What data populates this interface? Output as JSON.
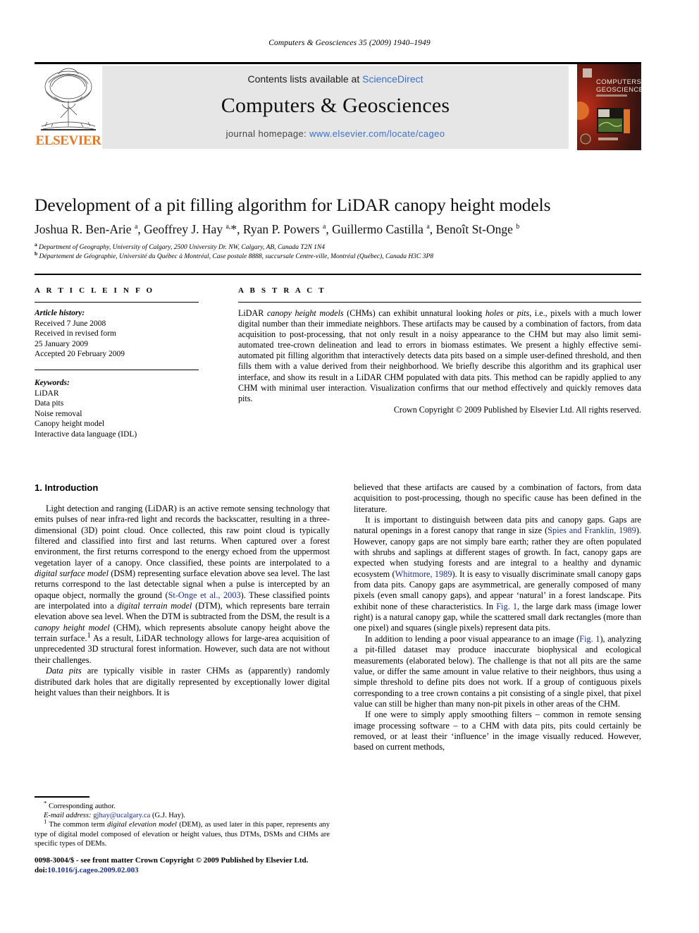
{
  "running_head": "Computers & Geosciences 35 (2009) 1940–1949",
  "masthead": {
    "publisher_name": "ELSEVIER",
    "contents_prefix": "Contents lists available at ",
    "contents_link": "ScienceDirect",
    "journal_name": "Computers & Geosciences",
    "homepage_prefix": "journal homepage: ",
    "homepage_url": "www.elsevier.com/locate/cageo",
    "cover_title_line1": "COMPUTERS",
    "cover_title_line2": "GEOSCIENCES",
    "cover_accent": "#e87722",
    "cover_bg": "#3a1510"
  },
  "article": {
    "title": "Development of a pit filling algorithm for LiDAR canopy height models",
    "authors": "Joshua R. Ben-Arie a, Geoffrey J. Hay a,*, Ryan P. Powers a, Guillermo Castilla a, Benoît St-Onge b",
    "affiliation_a": "Department of Geography, University of Calgary, 2500 University Dr. NW, Calgary, AB, Canada T2N 1N4",
    "affiliation_b": "Département de Géographie, Université du Québec à Montréal, Case postale 8888, succursale Centre-ville, Montréal (Québec), Canada H3C 3P8"
  },
  "article_info": {
    "heading": "A R T I C L E   I N F O",
    "history_label": "Article history:",
    "history_lines": [
      "Received 7 June 2008",
      "Received in revised form",
      "25 January 2009",
      "Accepted 20 February 2009"
    ],
    "keywords_label": "Keywords:",
    "keywords": [
      "LiDAR",
      "Data pits",
      "Noise removal",
      "Canopy height model",
      "Interactive data language (IDL)"
    ]
  },
  "abstract": {
    "heading": "A B S T R A C T",
    "text_part_1": "LiDAR ",
    "italic_1": "canopy height models",
    "text_part_2": " (CHMs) can exhibit unnatural looking ",
    "italic_2": "holes",
    "text_part_3": " or ",
    "italic_3": "pits",
    "text_part_4": ", i.e., pixels with a much lower digital number than their immediate neighbors. These artifacts may be caused by a combination of factors, from data acquisition to post-processing, that not only result in a noisy appearance to the CHM but may also limit semi-automated tree-crown delineation and lead to errors in biomass estimates. We present a highly effective semi-automated pit filling algorithm that interactively detects data pits based on a simple user-defined threshold, and then fills them with a value derived from their neighborhood. We briefly describe this algorithm and its graphical user interface, and show its result in a LiDAR CHM populated with data pits. This method can be rapidly applied to any CHM with minimal user interaction. Visualization confirms that our method effectively and quickly removes data pits.",
    "copyright": "Crown Copyright © 2009 Published by Elsevier Ltd. All rights reserved."
  },
  "body": {
    "section_heading": "1. Introduction",
    "left_paragraphs": [
      {
        "id": "p1",
        "segments": [
          {
            "t": "Light detection and ranging (LiDAR) is an active remote sensing technology that emits pulses of near infra-red light and records the backscatter, resulting in a three-dimensional (3D) point cloud. Once collected, this raw point cloud is typically filtered and classified into first and last returns. When captured over a forest environment, the first returns correspond to the energy echoed from the uppermost vegetation layer of a canopy. Once classified, these points are interpolated to a ",
            "s": "plain"
          },
          {
            "t": "digital surface model",
            "s": "italic"
          },
          {
            "t": " (DSM) representing surface elevation above sea level. The last returns correspond to the last detectable signal when a pulse is intercepted by an opaque object, normally the ground (",
            "s": "plain"
          },
          {
            "t": "St-Onge et al., 2003",
            "s": "ref"
          },
          {
            "t": "). These classified points are interpolated into a ",
            "s": "plain"
          },
          {
            "t": "digital terrain model",
            "s": "italic"
          },
          {
            "t": " (DTM), which represents bare terrain elevation above sea level. When the DTM is subtracted from the DSM, the result is a ",
            "s": "plain"
          },
          {
            "t": "canopy height model",
            "s": "italic"
          },
          {
            "t": " (CHM), which represents absolute canopy height above the terrain surface.",
            "s": "plain"
          },
          {
            "t": "1",
            "s": "sup"
          },
          {
            "t": " As a result, LiDAR technology allows for large-area acquisition of unprecedented 3D structural forest information. However, such data are not without their challenges.",
            "s": "plain"
          }
        ]
      },
      {
        "id": "p2",
        "segments": [
          {
            "t": "Data pits",
            "s": "italic"
          },
          {
            "t": " are typically visible in raster CHMs as (apparently) randomly distributed dark holes that are digitally represented by exceptionally lower digital height values than their neighbors. It is",
            "s": "plain"
          }
        ]
      }
    ],
    "right_paragraphs": [
      {
        "id": "p3",
        "indent": false,
        "segments": [
          {
            "t": "believed that these artifacts are caused by a combination of factors, from data acquisition to post-processing, though no specific cause has been defined in the literature.",
            "s": "plain"
          }
        ]
      },
      {
        "id": "p4",
        "indent": true,
        "segments": [
          {
            "t": "It is important to distinguish between data pits and canopy gaps. Gaps are natural openings in a forest canopy that range in size (",
            "s": "plain"
          },
          {
            "t": "Spies and Franklin, 1989",
            "s": "ref"
          },
          {
            "t": "). However, canopy gaps are not simply bare earth; rather they are often populated with shrubs and saplings at different stages of growth. In fact, canopy gaps are expected when studying forests and are integral to a healthy and dynamic ecosystem (",
            "s": "plain"
          },
          {
            "t": "Whitmore, 1989",
            "s": "ref"
          },
          {
            "t": "). It is easy to visually discriminate small canopy gaps from data pits. Canopy gaps are asymmetrical, are generally composed of many pixels (even small canopy gaps), and appear ‘natural’ in a forest landscape. Pits exhibit none of these characteristics. In ",
            "s": "plain"
          },
          {
            "t": "Fig. 1",
            "s": "ref"
          },
          {
            "t": ", the large dark mass (image lower right) is a natural canopy gap, while the scattered small dark rectangles (more than one pixel) and squares (single pixels) represent data pits.",
            "s": "plain"
          }
        ]
      },
      {
        "id": "p5",
        "indent": true,
        "segments": [
          {
            "t": "In addition to lending a poor visual appearance to an image (",
            "s": "plain"
          },
          {
            "t": "Fig. 1",
            "s": "ref"
          },
          {
            "t": "), analyzing a pit-filled dataset may produce inaccurate biophysical and ecological measurements (elaborated below). The challenge is that not all pits are the same value, or differ the same amount in value relative to their neighbors, thus using a simple threshold to define pits does not work. If a group of contiguous pixels corresponding to a tree crown contains a pit consisting of a single pixel, that pixel value can still be higher than many non-pit pixels in other areas of the CHM.",
            "s": "plain"
          }
        ]
      },
      {
        "id": "p6",
        "indent": true,
        "segments": [
          {
            "t": "If one were to simply apply smoothing filters – common in remote sensing image processing software – to a CHM with data pits, pits could certainly be removed, or at least their ‘influence’ in the image visually reduced. However, based on current methods,",
            "s": "plain"
          }
        ]
      }
    ]
  },
  "footnotes": {
    "corresponding_marker": "*",
    "corresponding_text": "Corresponding author.",
    "email_label": "E-mail address:",
    "email_link": "gjhay@ucalgary.ca",
    "email_suffix": " (G.J. Hay).",
    "note_marker": "1",
    "note_part_1": " The common term ",
    "note_italic": "digital elevation model",
    "note_part_2": " (DEM), as used later in this paper, represents any type of digital model composed of elevation or height values, thus DTMs, DSMs and CHMs are specific types of DEMs."
  },
  "colophon": {
    "line1": "0098-3004/$ - see front matter Crown Copyright © 2009 Published by Elsevier Ltd.",
    "doi_label": "doi:",
    "doi_value": "10.1016/j.cageo.2009.02.003"
  }
}
